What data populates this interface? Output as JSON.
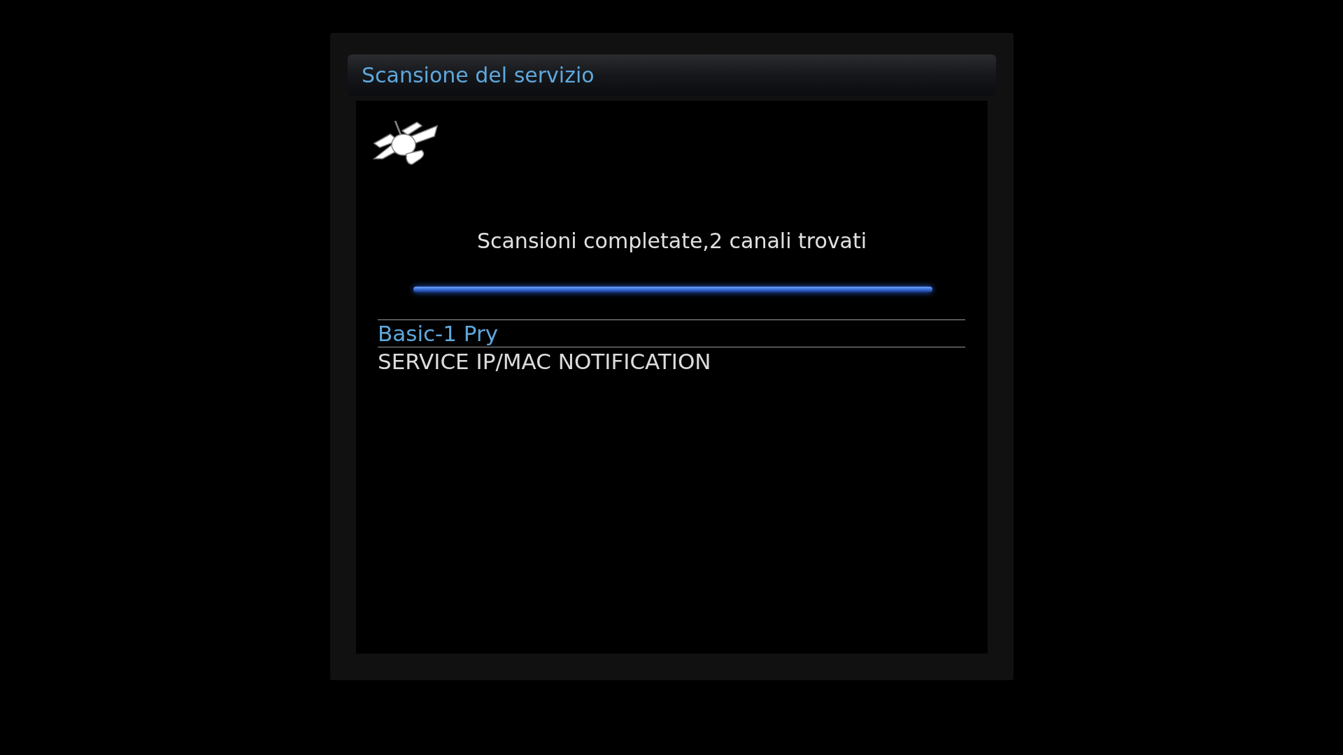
{
  "window": {
    "title": "Scansione del servizio"
  },
  "scan": {
    "message": "Scansioni completate,2 canali trovati",
    "progress": {
      "level": 1
    }
  },
  "channels": [
    {
      "name": "Basic-1 Pry",
      "selected": true
    },
    {
      "name": "SERVICE IP/MAC NOTIFICATION",
      "selected": false
    }
  ]
}
